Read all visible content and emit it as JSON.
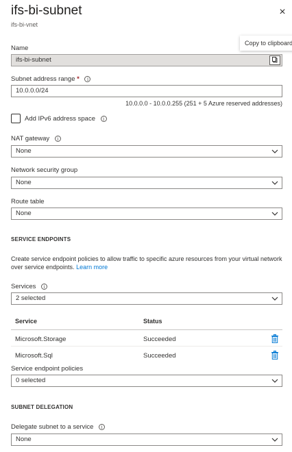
{
  "panel": {
    "title": "ifs-bi-subnet",
    "subtitle": "ifs-bi-vnet",
    "close_icon": "×"
  },
  "tooltip": "Copy to clipboard",
  "name_field": {
    "label": "Name",
    "value": "ifs-bi-subnet"
  },
  "address_range": {
    "label": "Subnet address range",
    "required": "*",
    "value": "10.0.0.0/24",
    "hint": "10.0.0.0 - 10.0.0.255 (251 + 5 Azure reserved addresses)"
  },
  "ipv6": {
    "label": "Add IPv6 address space",
    "checked": false
  },
  "nat_gateway": {
    "label": "NAT gateway",
    "value": "None"
  },
  "nsg": {
    "label": "Network security group",
    "value": "None"
  },
  "route_table": {
    "label": "Route table",
    "value": "None"
  },
  "service_endpoints": {
    "heading": "SERVICE ENDPOINTS",
    "description_line1": "Create service endpoint policies to allow traffic to specific azure resources from your virtual network",
    "description_line2": "over service endpoints.",
    "learn_more": "Learn more",
    "services_label": "Services",
    "services_value": "2 selected",
    "columns": [
      "Service",
      "Status"
    ],
    "rows": [
      {
        "service": "Microsoft.Storage",
        "status": "Succeeded"
      },
      {
        "service": "Microsoft.Sql",
        "status": "Succeeded"
      }
    ],
    "policies_label": "Service endpoint policies",
    "policies_value": "0 selected"
  },
  "delegation": {
    "heading": "SUBNET DELEGATION",
    "label": "Delegate subnet to a service",
    "value": "None"
  },
  "colors": {
    "accent": "#0078d4",
    "required": "#a4262c",
    "border": "#8a8886"
  }
}
